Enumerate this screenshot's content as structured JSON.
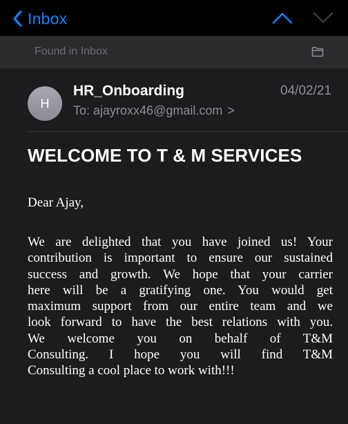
{
  "nav": {
    "back_label": "Inbox",
    "up_icon": "chevron-up-icon",
    "down_icon": "chevron-down-icon",
    "accent_color": "#0a84ff"
  },
  "banner": {
    "text": "Found in Inbox",
    "icon": "folder-icon"
  },
  "message": {
    "avatar_initial": "H",
    "sender": "HR_Onboarding",
    "date": "04/02/21",
    "to_label": "To:",
    "recipient": "ajayroxx46@gmail.com",
    "recipient_chevron": ">",
    "subject": "WELCOME TO T & M SERVICES",
    "greeting": "Dear Ajay,",
    "body_lines": [
      "We are delighted that you have joined us! Your",
      "contribution is important to ensure our sustained",
      "success and growth. We hope that your carrier",
      "here will be a gratifying one. You would get",
      "maximum support from our entire team and we",
      "look forward to have the best relations with you.",
      "We welcome you on behalf of T&M",
      "Consulting. I hope you will find T&M",
      "Consulting a cool place to work with!!!"
    ]
  }
}
